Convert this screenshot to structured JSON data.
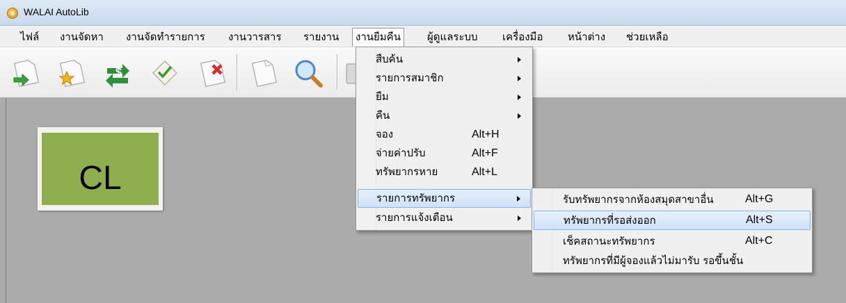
{
  "window": {
    "title": "WALAI AutoLib"
  },
  "menubar": {
    "items": [
      {
        "label": "ไฟล์"
      },
      {
        "label": "งานจัดหา"
      },
      {
        "label": "งานจัดทำรายการ"
      },
      {
        "label": "งานวารสาร"
      },
      {
        "label": "รายงาน"
      },
      {
        "label": "งานยืมคืน"
      },
      {
        "label": "ผู้ดูแลระบบ"
      },
      {
        "label": "เครื่องมือ"
      },
      {
        "label": "หน้าต่าง"
      },
      {
        "label": "ช่วยเหลือ"
      }
    ]
  },
  "toolbar": {
    "icons": [
      "doc-arrow-in-icon",
      "doc-star-icon",
      "dollar-exchange-icon",
      "doc-checklist-icon",
      "doc-delete-icon",
      "blank-page-icon",
      "magnifier-icon",
      "calculator-icon"
    ]
  },
  "tile": {
    "label": "CL"
  },
  "dropdown": {
    "items": [
      {
        "label": "สืบค้น",
        "shortcut": "",
        "submenu": true
      },
      {
        "label": "รายการสมาชิก",
        "shortcut": "",
        "submenu": true
      },
      {
        "label": "ยืม",
        "shortcut": "",
        "submenu": true
      },
      {
        "label": "คืน",
        "shortcut": "",
        "submenu": true
      },
      {
        "label": "จอง",
        "shortcut": "Alt+H",
        "submenu": false
      },
      {
        "label": "จ่ายค่าปรับ",
        "shortcut": "Alt+F",
        "submenu": false
      },
      {
        "label": "ทรัพยากรหาย",
        "shortcut": "Alt+L",
        "submenu": false
      },
      {
        "label": "รายการทรัพยากร",
        "shortcut": "",
        "submenu": true
      },
      {
        "label": "รายการแจ้งเตือน",
        "shortcut": "",
        "submenu": true
      }
    ]
  },
  "submenu": {
    "items": [
      {
        "label": "รับทรัพยากรจากห้องสมุดสาขาอื่น",
        "shortcut": "Alt+G"
      },
      {
        "label": "ทรัพยากรที่รอส่งออก",
        "shortcut": "Alt+S"
      },
      {
        "label": "เช็คสถานะทรัพยากร",
        "shortcut": "Alt+C"
      },
      {
        "label": "ทรัพยากรที่มีผู้จองแล้วไม่มารับ รอขึ้นชั้น",
        "shortcut": ""
      }
    ]
  },
  "colors": {
    "highlight": "#cfe2f7",
    "tile": "#8eae4f",
    "workspace": "#ababab"
  }
}
